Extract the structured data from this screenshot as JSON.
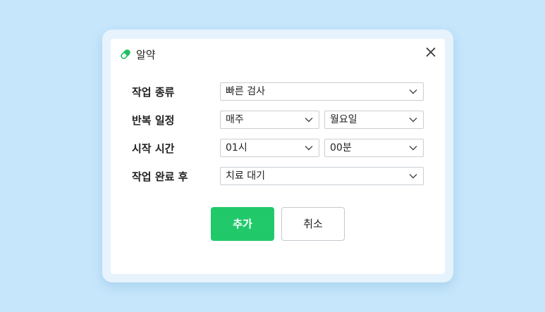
{
  "dialog": {
    "title": "알약",
    "title_icon": "pill-icon",
    "close_icon": "close-icon"
  },
  "form": {
    "task_type": {
      "label": "작업 종류",
      "value": "빠른 검사"
    },
    "repeat": {
      "label": "반복 일정",
      "frequency": "매주",
      "day": "월요일"
    },
    "start_time": {
      "label": "시작 시간",
      "hour": "01시",
      "minute": "00분"
    },
    "after_done": {
      "label": "작업 완료 후",
      "value": "치료 대기"
    }
  },
  "buttons": {
    "add": "추가",
    "cancel": "취소"
  },
  "colors": {
    "background": "#c6e6fb",
    "accent": "#21c96b",
    "border": "#c9ced3"
  }
}
